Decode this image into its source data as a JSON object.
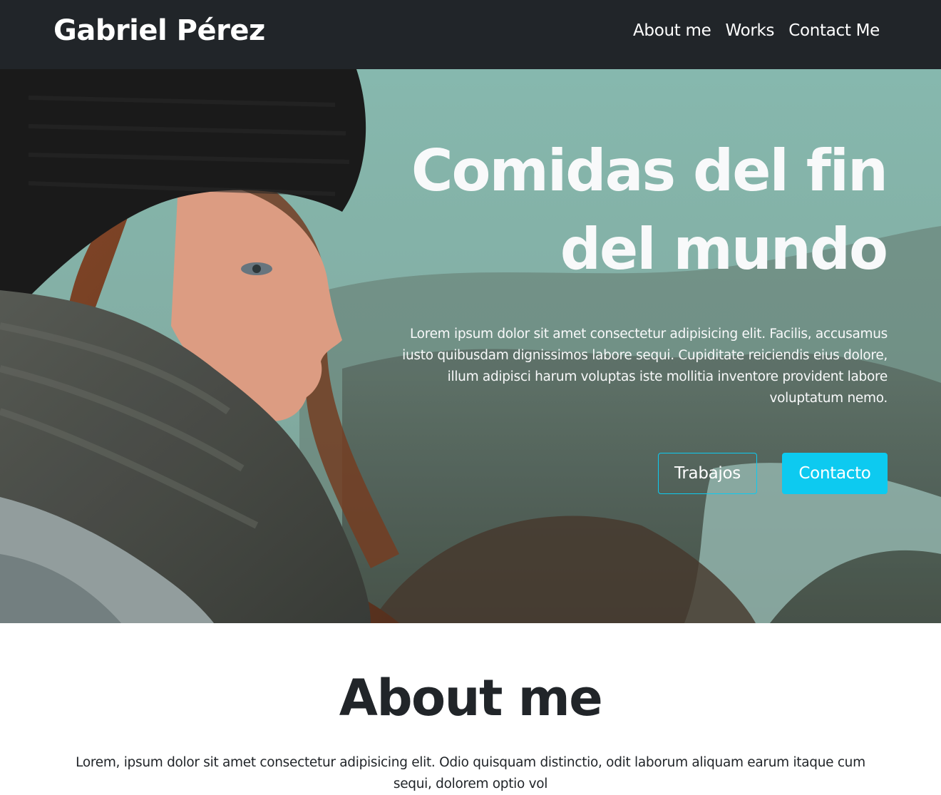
{
  "navbar": {
    "brand": "Gabriel Pérez",
    "links": [
      "About me",
      "Works",
      "Contact Me"
    ]
  },
  "hero": {
    "title_line1": "Comidas del fin",
    "title_line2": "del mundo",
    "text": "Lorem ipsum dolor sit amet consectetur adipisicing elit. Facilis, accusamus iusto quibusdam dignissimos labore sequi. Cupiditate reiciendis eius dolore, illum adipisci harum voluptas iste mollitia inventore provident labore voluptatum nemo.",
    "buttons": {
      "works": "Trabajos",
      "contact": "Contacto"
    },
    "image": "portrait-woman-beanie-scarf-landscape"
  },
  "about": {
    "title": "About me",
    "text": "Lorem, ipsum dolor sit amet consectetur adipisicing elit. Odio quisquam distinctio, odit laborum aliquam earum itaque cum sequi, dolorem optio vol"
  },
  "colors": {
    "navbar_bg": "#212529",
    "accent": "#0dcaf0",
    "hero_text": "#f8f9fa",
    "body_text": "#212529"
  }
}
